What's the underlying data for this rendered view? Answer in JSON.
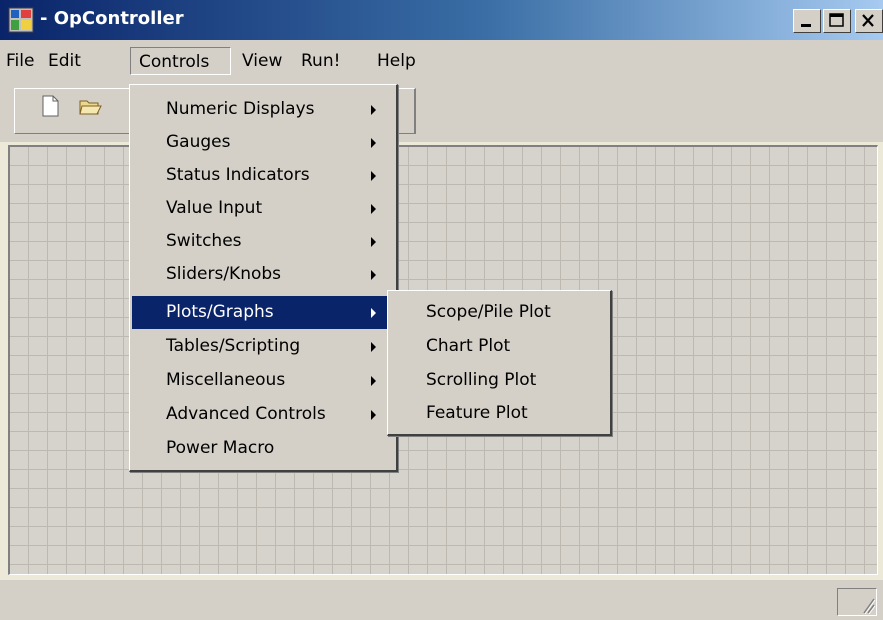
{
  "window": {
    "title": "- OpController"
  },
  "menubar": [
    {
      "label": "File"
    },
    {
      "label": "Edit"
    },
    {
      "label": "Controls"
    },
    {
      "label": "View"
    },
    {
      "label": "Run!"
    },
    {
      "label": "Help"
    }
  ],
  "controls_menu": [
    {
      "label": "Numeric Displays"
    },
    {
      "label": "Gauges"
    },
    {
      "label": "Status Indicators"
    },
    {
      "label": "Value Input"
    },
    {
      "label": "Switches"
    },
    {
      "label": "Sliders/Knobs"
    },
    {
      "label": "Plots/Graphs"
    },
    {
      "label": "Tables/Scripting"
    },
    {
      "label": "Miscellaneous"
    },
    {
      "label": "Advanced Controls"
    },
    {
      "label": "Power Macro"
    }
  ],
  "plots_submenu": [
    {
      "label": "Scope/Pile Plot"
    },
    {
      "label": "Chart Plot"
    },
    {
      "label": "Scrolling Plot"
    },
    {
      "label": "Feature Plot"
    }
  ],
  "colors": {
    "highlight": "#0a246a",
    "face": "#d4d0c8",
    "title_start": "#0a246a",
    "title_end": "#a6caf0"
  },
  "icons": [
    "app-icon",
    "minimize-icon",
    "maximize-icon",
    "close-icon",
    "new-file-icon",
    "open-folder-icon",
    "submenu-arrow-icon",
    "size-grip-icon"
  ]
}
